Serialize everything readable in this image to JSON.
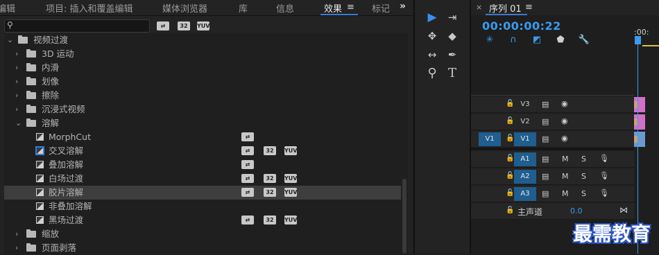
{
  "effects_panel": {
    "tabs": [
      {
        "label": "编辑"
      },
      {
        "label": "项目: 插入和覆盖编辑"
      },
      {
        "label": "媒体浏览器"
      },
      {
        "label": "库"
      },
      {
        "label": "信息"
      },
      {
        "label": "效果"
      },
      {
        "label": "标记"
      }
    ],
    "active_tab": "效果",
    "overflow_label": "»",
    "menu_label": "≡",
    "search": {
      "value": "",
      "placeholder": ""
    },
    "filter_badges": [
      "⇄",
      "32",
      "YUV"
    ],
    "tree": [
      {
        "label": "视频过渡",
        "type": "folder",
        "expanded": true,
        "level": 0
      },
      {
        "label": "3D 运动",
        "type": "folder",
        "expanded": false,
        "level": 1
      },
      {
        "label": "内滑",
        "type": "folder",
        "expanded": false,
        "level": 1
      },
      {
        "label": "划像",
        "type": "folder",
        "expanded": false,
        "level": 1
      },
      {
        "label": "擦除",
        "type": "folder",
        "expanded": false,
        "level": 1
      },
      {
        "label": "沉浸式视频",
        "type": "folder",
        "expanded": false,
        "level": 1
      },
      {
        "label": "溶解",
        "type": "folder",
        "expanded": true,
        "level": 1
      },
      {
        "label": "MorphCut",
        "type": "effect",
        "level": 2,
        "badges": [
          "⇄"
        ]
      },
      {
        "label": "交叉溶解",
        "type": "effect",
        "level": 2,
        "badges": [
          "⇄",
          "32",
          "YUV"
        ],
        "default": true
      },
      {
        "label": "叠加溶解",
        "type": "effect",
        "level": 2,
        "badges": [
          "⇄"
        ]
      },
      {
        "label": "白场过渡",
        "type": "effect",
        "level": 2,
        "badges": [
          "⇄",
          "32",
          "YUV"
        ]
      },
      {
        "label": "胶片溶解",
        "type": "effect",
        "level": 2,
        "badges": [
          "⇄",
          "32",
          "YUV"
        ],
        "selected": true
      },
      {
        "label": "非叠加溶解",
        "type": "effect",
        "level": 2,
        "badges": [
          "⇄"
        ]
      },
      {
        "label": "黑场过渡",
        "type": "effect",
        "level": 2,
        "badges": [
          "⇄",
          "32",
          "YUV"
        ]
      },
      {
        "label": "缩放",
        "type": "folder",
        "expanded": false,
        "level": 1
      },
      {
        "label": "页面剥落",
        "type": "folder",
        "expanded": false,
        "level": 1
      }
    ]
  },
  "tools": [
    {
      "name": "selection-tool",
      "glyph": "▶",
      "active": true
    },
    {
      "name": "track-select-forward-tool",
      "glyph": "⇥"
    },
    {
      "name": "ripple-edit-tool",
      "glyph": "✥"
    },
    {
      "name": "razor-tool",
      "glyph": "◆"
    },
    {
      "name": "slip-tool",
      "glyph": "↔"
    },
    {
      "name": "pen-tool",
      "glyph": "✒"
    },
    {
      "name": "zoom-tool",
      "glyph": "⚲"
    },
    {
      "name": "type-tool",
      "glyph": "T"
    }
  ],
  "timeline": {
    "close_label": "×",
    "sequence_name": "序列 01",
    "menu_label": "≡",
    "timecode": "00:00:00:22",
    "ruler_label": ":00:",
    "video_tracks": [
      {
        "name": "V3",
        "source": ""
      },
      {
        "name": "V2",
        "source": ""
      },
      {
        "name": "V1",
        "source": "V1"
      }
    ],
    "audio_tracks": [
      {
        "name": "A1",
        "m": "M",
        "s": "S"
      },
      {
        "name": "A2",
        "m": "M",
        "s": "S"
      },
      {
        "name": "A3",
        "m": "M",
        "s": "S"
      }
    ],
    "master": {
      "label": "主声道",
      "value": "0.0"
    },
    "clip_colors": {
      "video_pink": "#d070c8",
      "video_blue": "#6a9ad0"
    }
  },
  "watermark": "最需教育",
  "colors": {
    "accent": "#3a9bf0",
    "track_target": "#1f5e8f"
  }
}
